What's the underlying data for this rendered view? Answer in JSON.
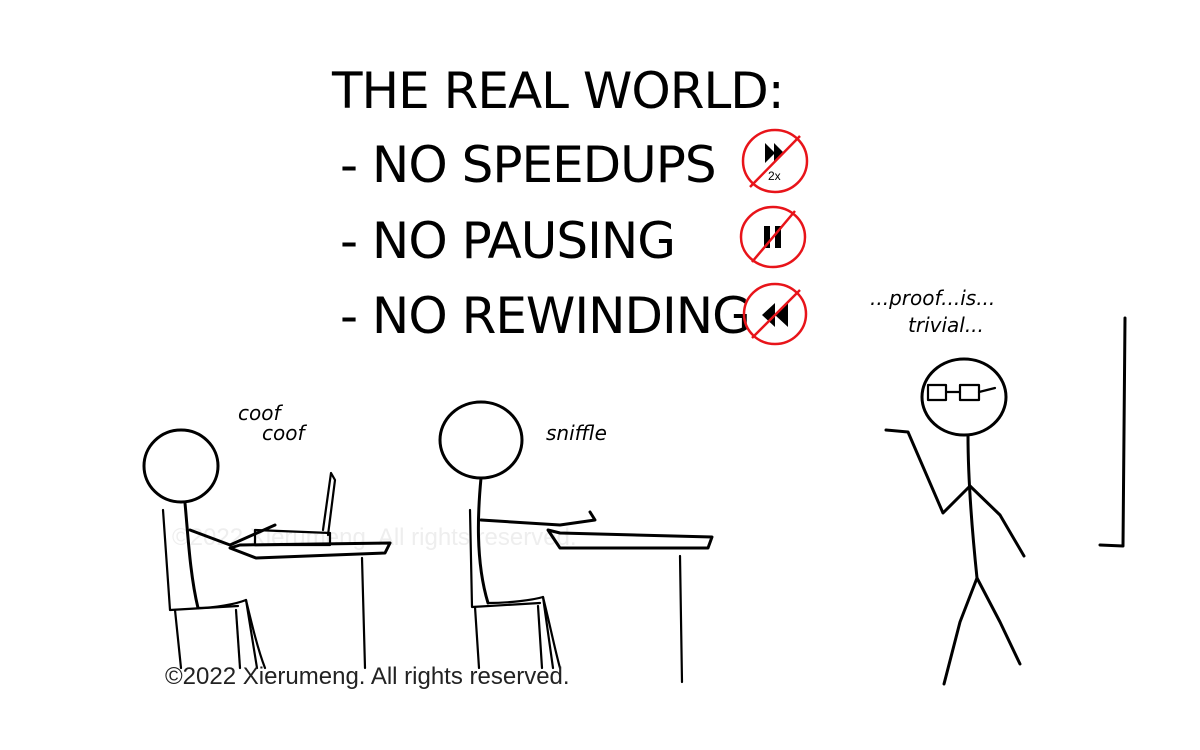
{
  "title": "THE REAL WORLD:",
  "rules": [
    {
      "text": "- NO SPEEDUPS",
      "icon": "fast-forward-icon",
      "badge": "2x"
    },
    {
      "text": "- NO PAUSING",
      "icon": "pause-icon"
    },
    {
      "text": "- NO REWINDING",
      "icon": "rewind-icon"
    }
  ],
  "speech": {
    "student_left_line1": "coof",
    "student_left_line2": "coof",
    "student_middle": "sniffle",
    "teacher_line1": "...proof...is...",
    "teacher_line2": "trivial..."
  },
  "watermark": "©2022 Xierumeng. All rights reserved.",
  "copyright": "©2022 Xierumeng. All rights reserved.",
  "colors": {
    "ink": "#000000",
    "ban_red": "#e8141a",
    "background": "#ffffff"
  }
}
